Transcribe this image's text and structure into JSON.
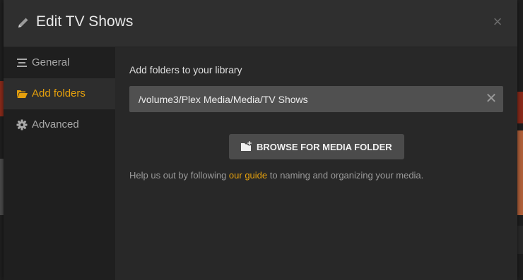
{
  "colors": {
    "accent": "#e5a00d",
    "modal_bg": "#282828",
    "sidebar_bg": "#1f1f1f",
    "field_bg": "#505050",
    "button_bg": "#4b4b4b"
  },
  "modal": {
    "title": "Edit TV Shows",
    "title_icon": "pencil-icon",
    "close_icon": "close-icon",
    "close_glyph": "×"
  },
  "sidebar": {
    "items": [
      {
        "label": "General",
        "icon": "list-icon",
        "active": false
      },
      {
        "label": "Add folders",
        "icon": "folder-open-icon",
        "active": true
      },
      {
        "label": "Advanced",
        "icon": "gear-icon",
        "active": false
      }
    ]
  },
  "main": {
    "section_label": "Add folders to your library",
    "folder_path": "/volume3/Plex Media/Media/TV Shows",
    "clear_glyph": "✕",
    "browse_button": {
      "label": "BROWSE FOR MEDIA FOLDER",
      "icon": "folder-add-icon"
    },
    "help": {
      "before": "Help us out by following ",
      "link": "our guide",
      "after": " to naming and organizing your media."
    }
  }
}
